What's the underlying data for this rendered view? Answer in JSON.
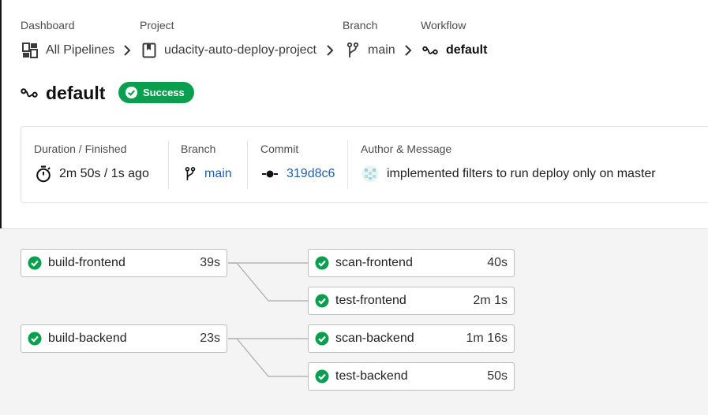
{
  "breadcrumb": {
    "dashboard": {
      "label": "Dashboard",
      "value": "All Pipelines"
    },
    "project": {
      "label": "Project",
      "value": "udacity-auto-deploy-project"
    },
    "branch": {
      "label": "Branch",
      "value": "main"
    },
    "workflow": {
      "label": "Workflow",
      "value": "default"
    }
  },
  "workflow": {
    "title": "default",
    "status": "Success"
  },
  "summary": {
    "duration_label": "Duration / Finished",
    "duration_value": "2m 50s / 1s ago",
    "branch_label": "Branch",
    "branch_value": "main",
    "commit_label": "Commit",
    "commit_value": "319d8c6",
    "author_label": "Author & Message",
    "author_message": "implemented filters to run deploy only on master"
  },
  "jobs": [
    {
      "name": "build-frontend",
      "duration": "39s",
      "status": "success"
    },
    {
      "name": "scan-frontend",
      "duration": "40s",
      "status": "success"
    },
    {
      "name": "test-frontend",
      "duration": "2m 1s",
      "status": "success"
    },
    {
      "name": "build-backend",
      "duration": "23s",
      "status": "success"
    },
    {
      "name": "scan-backend",
      "duration": "1m 16s",
      "status": "success"
    },
    {
      "name": "test-backend",
      "duration": "50s",
      "status": "success"
    }
  ],
  "colors": {
    "success": "#0a9e4f",
    "link": "#1f5fa8"
  },
  "icons": [
    "dashboard-icon",
    "project-icon",
    "branch-icon",
    "workflow-icon",
    "chevron-right-icon",
    "stopwatch-icon",
    "commit-icon",
    "avatar-icon",
    "check-circle-icon"
  ]
}
